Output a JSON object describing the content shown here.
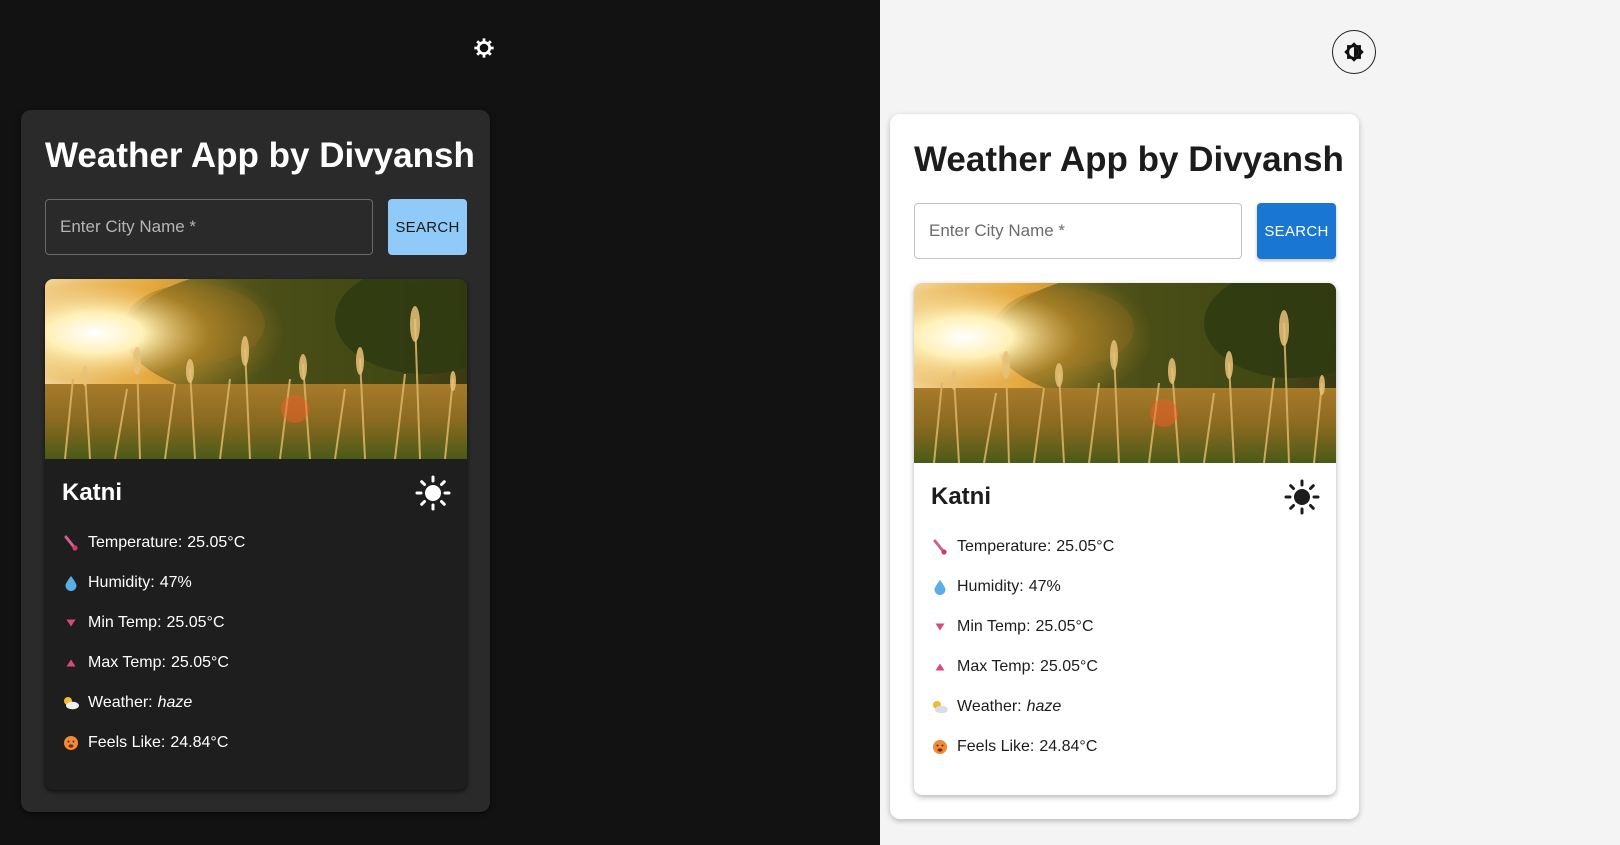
{
  "app": {
    "title": "Weather App by Divyansh",
    "search": {
      "placeholder": "Enter City Name *",
      "value": "",
      "button_label": "SEARCH"
    },
    "theme_toggle_icon_dark": "gear-sun-icon",
    "theme_toggle_icon_light": "contrast-brightness-icon"
  },
  "weather": {
    "city": "Katni",
    "condition_icon": "sun-icon",
    "stats": [
      {
        "icon": "thermometer-icon",
        "label": "Temperature:",
        "value": "25.05°C"
      },
      {
        "icon": "droplet-icon",
        "label": "Humidity:",
        "value": "47%"
      },
      {
        "icon": "down-triangle-icon",
        "label": "Min Temp:",
        "value": "25.05°C"
      },
      {
        "icon": "up-triangle-icon",
        "label": "Max Temp:",
        "value": "25.05°C"
      },
      {
        "icon": "sun-behind-cloud-icon",
        "label": "Weather:",
        "value": "haze"
      },
      {
        "icon": "hot-face-icon",
        "label": "Feels Like:",
        "value": "24.84°C"
      }
    ]
  },
  "colors": {
    "dark_background": "#121212",
    "dark_panel": "#2a2a2a",
    "dark_card": "#1e1e1e",
    "dark_button": "#90caf9",
    "light_background": "#f4f4f4",
    "light_panel": "#ffffff",
    "light_button": "#1976d2"
  }
}
